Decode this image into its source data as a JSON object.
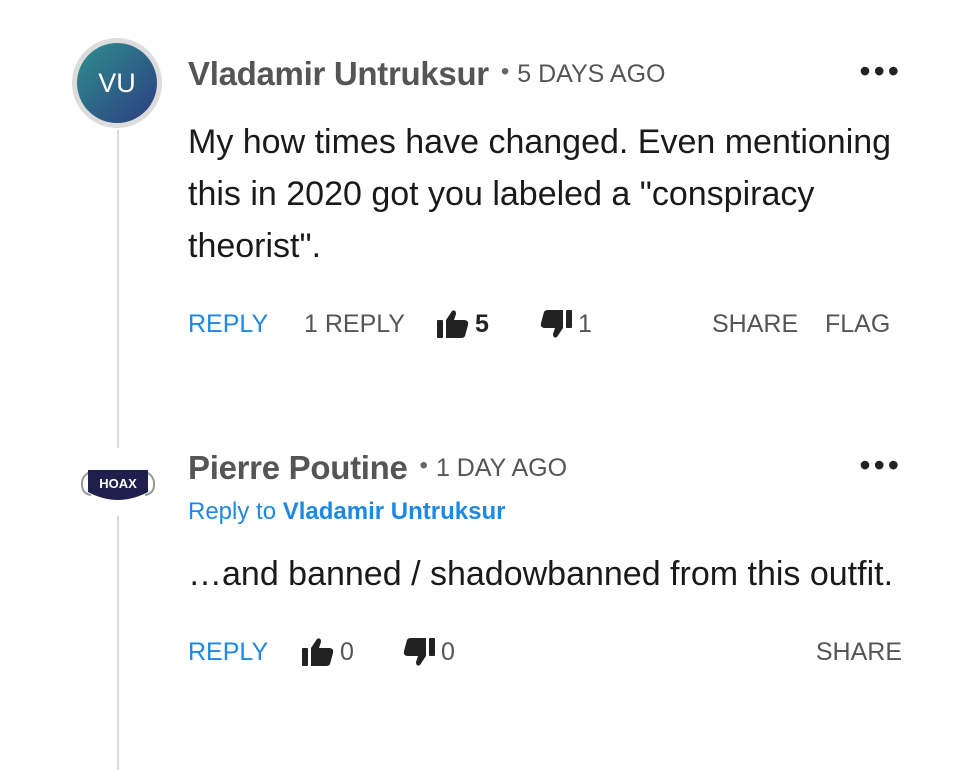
{
  "comments": [
    {
      "avatar_text": "VU",
      "author": "Vladamir Untruksur",
      "separator": "•",
      "time": "5 DAYS AGO",
      "menu": "•••",
      "body": "My how times have changed. Even mentioning this in 2020 got you labeled a \"conspiracy theorist\".",
      "actions": {
        "reply": "REPLY",
        "replies": "1 REPLY",
        "upvotes": "5",
        "downvotes": "1",
        "share": "SHARE",
        "flag": "FLAG"
      }
    },
    {
      "avatar_text": "HOAX",
      "author": "Pierre Poutine",
      "separator": "•",
      "time": "1 DAY AGO",
      "menu": "•••",
      "reply_to_prefix": "Reply to",
      "reply_to_name": "Vladamir Untruksur",
      "body": "…and banned / shadowbanned from this outfit.",
      "actions": {
        "reply": "REPLY",
        "upvotes": "0",
        "downvotes": "0",
        "share": "SHARE"
      }
    }
  ],
  "colors": {
    "link_blue": "#1e88e5",
    "text_grey": "#555555",
    "thread_line": "#d9d9d9",
    "avatar_gradient": [
      "#2f8f8c",
      "#2b3c82"
    ],
    "hoax_mask": "#1e1f4d"
  },
  "icons": {
    "upvote": "thumbs-up-icon",
    "downvote": "thumbs-down-icon",
    "menu": "more-options-icon"
  }
}
